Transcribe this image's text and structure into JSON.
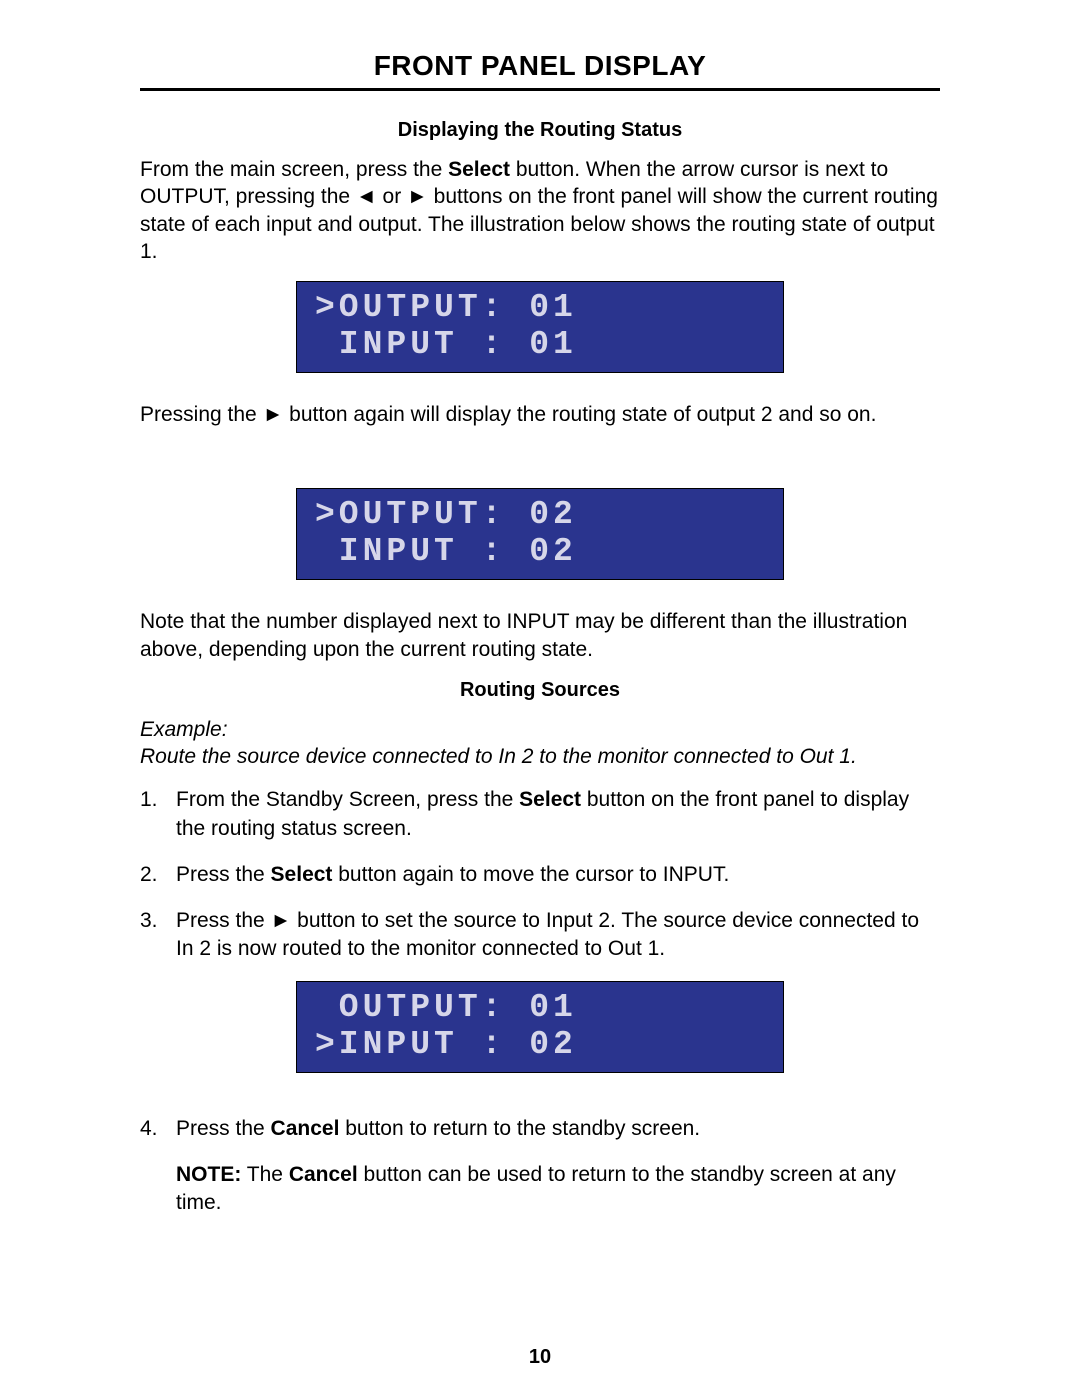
{
  "title": "FRONT PANEL DISPLAY",
  "section1": {
    "heading": "Displaying the Routing Status",
    "p1a": "From the main screen, press the ",
    "p1b": "Select",
    "p1c": " button.  When the arrow cursor is next to OUTPUT, pressing the ◄ or ► buttons on the front panel will show the current routing state of each input and output.  The illustration below shows the routing state of output 1.",
    "lcd1_line1": ">OUTPUT: 01",
    "lcd1_line2": " INPUT : 01",
    "p2": "Pressing the ► button again will display the routing state of output 2 and so on.",
    "lcd2_line1": ">OUTPUT: 02",
    "lcd2_line2": " INPUT : 02",
    "p3": "Note that the number displayed next to INPUT may be different than the illustration above, depending upon the current routing state."
  },
  "section2": {
    "heading": "Routing Sources",
    "example_label": "Example:",
    "example_text": "Route the source device connected to In 2 to the monitor connected to Out 1.",
    "step1_num": "1.",
    "step1a": "From the Standby Screen, press the ",
    "step1b": "Select",
    "step1c": " button on the front panel to display the routing status screen.",
    "step2_num": "2.",
    "step2a": "Press the ",
    "step2b": "Select",
    "step2c": " button again to move the cursor to INPUT.",
    "step3_num": "3.",
    "step3": "Press the ► button to set the source to Input 2.  The source device connected to In 2 is now routed to the monitor connected to Out 1.",
    "lcd3_line1": " OUTPUT: 01",
    "lcd3_line2": ">INPUT : 02",
    "step4_num": "4.",
    "step4a": "Press the ",
    "step4b": "Cancel",
    "step4c": " button to return to the standby screen.",
    "note_label": "NOTE:",
    "note_a": " The ",
    "note_b": "Cancel",
    "note_c": " button can be used to return to the standby screen at any time."
  },
  "page_number": "10"
}
